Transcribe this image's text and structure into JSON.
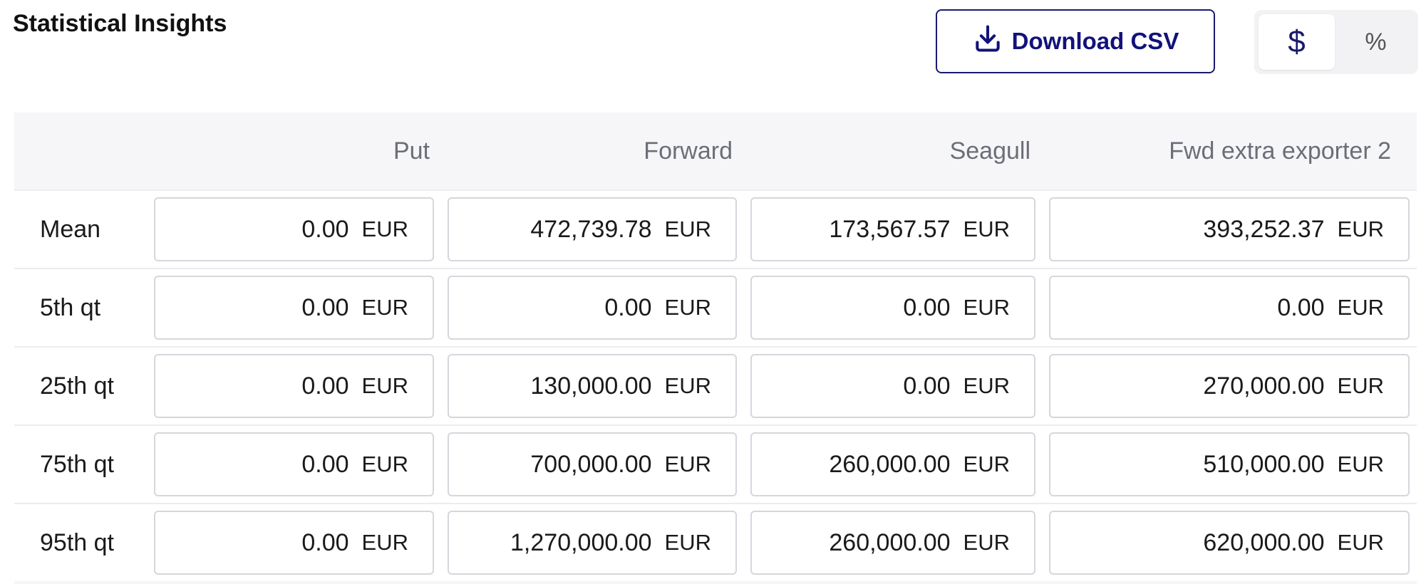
{
  "header": {
    "title": "Statistical Insights",
    "download_label": "Download CSV",
    "toggle": [
      {
        "label": "$",
        "active": true
      },
      {
        "label": "%",
        "active": false
      }
    ]
  },
  "table": {
    "columns": [
      "Put",
      "Forward",
      "Seagull",
      "Fwd extra exporter 2"
    ],
    "currency": "EUR",
    "rows": [
      {
        "label": "Mean",
        "values": [
          "0.00",
          "472,739.78",
          "173,567.57",
          "393,252.37"
        ]
      },
      {
        "label": "5th qt",
        "values": [
          "0.00",
          "0.00",
          "0.00",
          "0.00"
        ]
      },
      {
        "label": "25th qt",
        "values": [
          "0.00",
          "130,000.00",
          "0.00",
          "270,000.00"
        ]
      },
      {
        "label": "75th qt",
        "values": [
          "0.00",
          "700,000.00",
          "260,000.00",
          "510,000.00"
        ]
      },
      {
        "label": "95th qt",
        "values": [
          "0.00",
          "1,270,000.00",
          "260,000.00",
          "620,000.00"
        ]
      }
    ]
  },
  "colors": {
    "accent": "#1a1a6e",
    "header_bg": "#f6f6f8",
    "border": "#d6d7dc"
  }
}
